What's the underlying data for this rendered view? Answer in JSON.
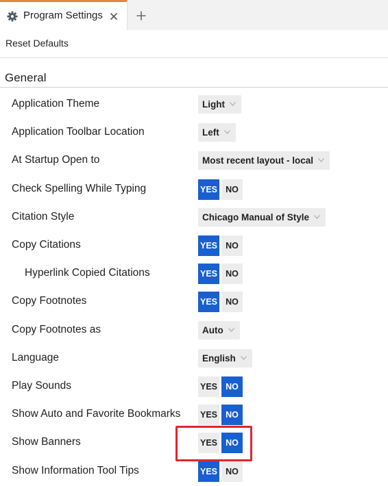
{
  "tab": {
    "title": "Program Settings",
    "icon": "gear-icon",
    "accent_color": "#e8843c"
  },
  "toolbar": {
    "reset_label": "Reset Defaults"
  },
  "section": {
    "title": "General"
  },
  "toggle_labels": {
    "yes": "YES",
    "no": "NO"
  },
  "colors": {
    "toggle_active": "#1a5fd0",
    "highlight_border": "#e0262f"
  },
  "settings": [
    {
      "label": "Application Theme",
      "type": "dropdown",
      "value": "Light"
    },
    {
      "label": "Application Toolbar Location",
      "type": "dropdown",
      "value": "Left"
    },
    {
      "label": "At Startup Open to",
      "type": "dropdown",
      "value": "Most recent layout - local"
    },
    {
      "label": "Check Spelling While Typing",
      "type": "toggle",
      "value": "YES"
    },
    {
      "label": "Citation Style",
      "type": "dropdown",
      "value": "Chicago Manual of Style"
    },
    {
      "label": "Copy Citations",
      "type": "toggle",
      "value": "YES"
    },
    {
      "label": "Hyperlink Copied Citations",
      "type": "toggle",
      "value": "YES",
      "indent": true
    },
    {
      "label": "Copy Footnotes",
      "type": "toggle",
      "value": "YES"
    },
    {
      "label": "Copy Footnotes as",
      "type": "dropdown",
      "value": "Auto"
    },
    {
      "label": "Language",
      "type": "dropdown",
      "value": "English"
    },
    {
      "label": "Play Sounds",
      "type": "toggle",
      "value": "NO"
    },
    {
      "label": "Show Auto and Favorite Bookmarks",
      "type": "toggle",
      "value": "NO"
    },
    {
      "label": "Show Banners",
      "type": "toggle",
      "value": "NO",
      "highlighted": true
    },
    {
      "label": "Show Information Tool Tips",
      "type": "toggle",
      "value": "YES"
    }
  ]
}
